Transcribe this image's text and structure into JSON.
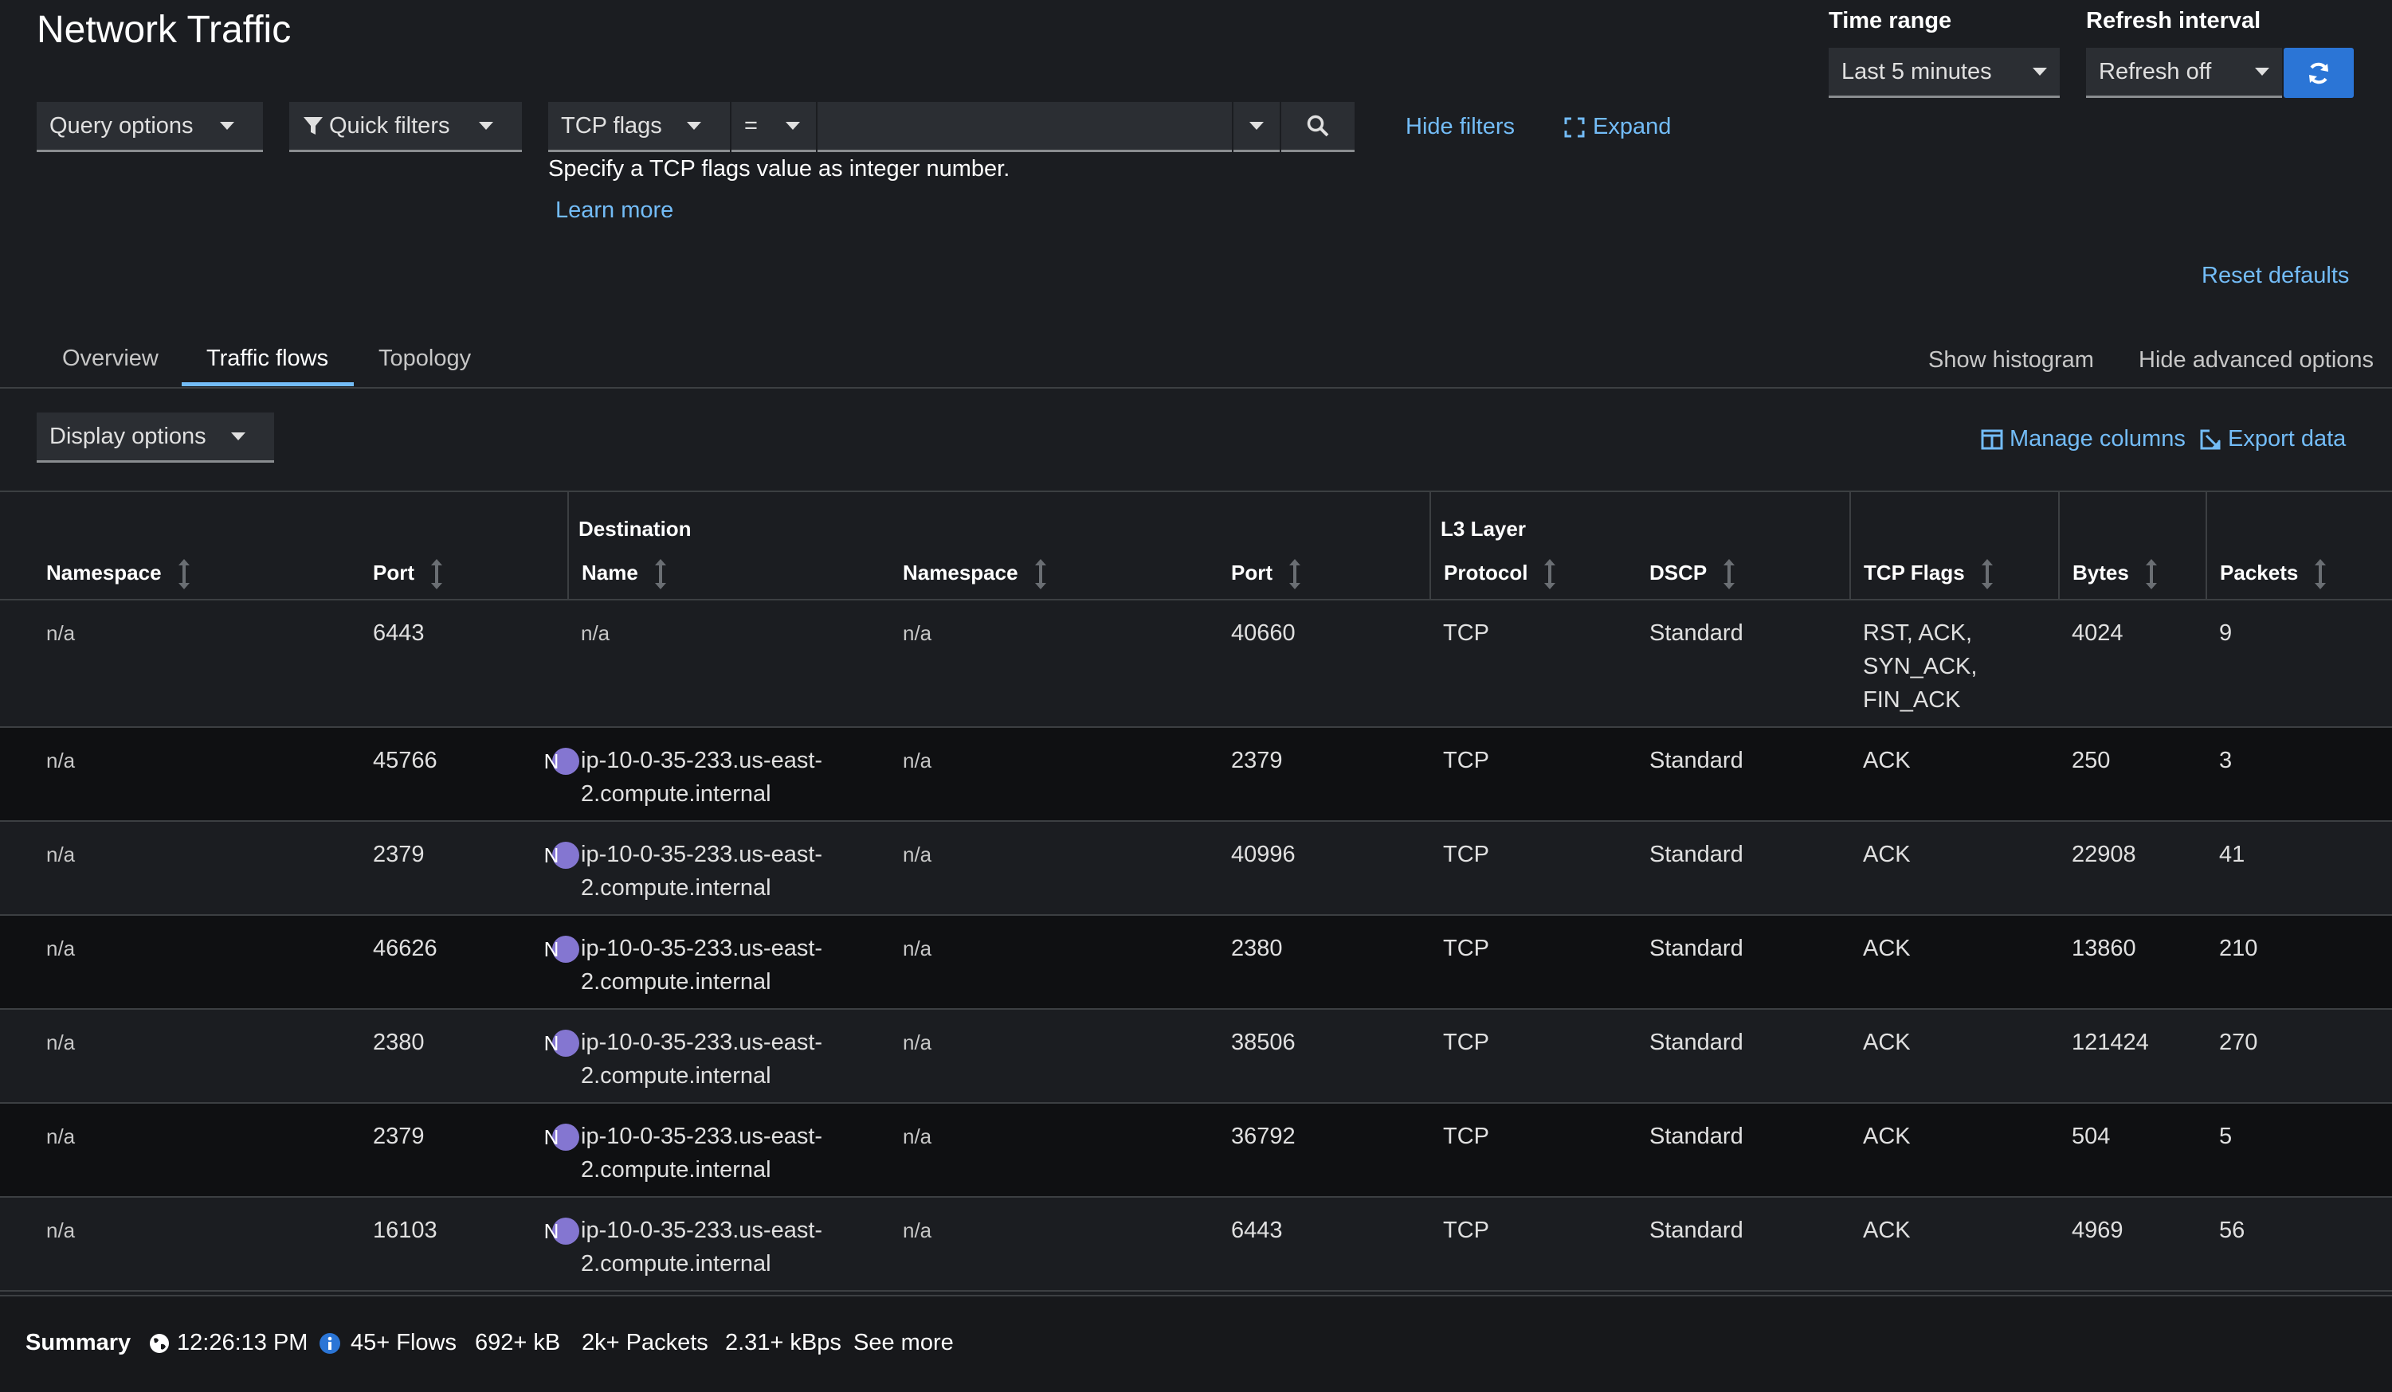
{
  "page": {
    "title": "Network Traffic"
  },
  "time_range": {
    "label": "Time range",
    "value": "Last 5 minutes"
  },
  "refresh": {
    "label": "Refresh interval",
    "value": "Refresh off"
  },
  "toolbar": {
    "query_options": "Query options",
    "quick_filters": "Quick filters",
    "filter_field": "TCP flags",
    "filter_operator": "=",
    "filter_value": "",
    "hide_filters": "Hide filters",
    "expand": "Expand",
    "helper_text": "Specify a TCP flags value as integer number.",
    "learn_more": "Learn more",
    "reset_defaults": "Reset defaults"
  },
  "tabs": [
    {
      "label": "Overview",
      "active": false
    },
    {
      "label": "Traffic flows",
      "active": true
    },
    {
      "label": "Topology",
      "active": false
    }
  ],
  "tab_actions": {
    "show_histogram": "Show histogram",
    "hide_advanced": "Hide advanced options"
  },
  "display_options": "Display options",
  "table_actions": {
    "manage_columns": "Manage columns",
    "export_data": "Export data"
  },
  "table": {
    "groups": {
      "destination": "Destination",
      "l3": "L3 Layer"
    },
    "columns": [
      "Namespace",
      "Port",
      "Name",
      "Namespace",
      "Port",
      "Protocol",
      "DSCP",
      "TCP Flags",
      "Bytes",
      "Packets"
    ],
    "rows": [
      {
        "src_ns": "n/a",
        "src_port": "6443",
        "dst_badge": "",
        "dst_name": "n/a",
        "dst_ns": "n/a",
        "dst_port": "40660",
        "protocol": "TCP",
        "dscp": "Standard",
        "flags": "RST, ACK, SYN_ACK, FIN_ACK",
        "bytes": "4024",
        "packets": "9"
      },
      {
        "src_ns": "n/a",
        "src_port": "45766",
        "dst_badge": "N",
        "dst_name": "ip-10-0-35-233.us-east-2.compute.internal",
        "dst_ns": "n/a",
        "dst_port": "2379",
        "protocol": "TCP",
        "dscp": "Standard",
        "flags": "ACK",
        "bytes": "250",
        "packets": "3"
      },
      {
        "src_ns": "n/a",
        "src_port": "2379",
        "dst_badge": "N",
        "dst_name": "ip-10-0-35-233.us-east-2.compute.internal",
        "dst_ns": "n/a",
        "dst_port": "40996",
        "protocol": "TCP",
        "dscp": "Standard",
        "flags": "ACK",
        "bytes": "22908",
        "packets": "41"
      },
      {
        "src_ns": "n/a",
        "src_port": "46626",
        "dst_badge": "N",
        "dst_name": "ip-10-0-35-233.us-east-2.compute.internal",
        "dst_ns": "n/a",
        "dst_port": "2380",
        "protocol": "TCP",
        "dscp": "Standard",
        "flags": "ACK",
        "bytes": "13860",
        "packets": "210"
      },
      {
        "src_ns": "n/a",
        "src_port": "2380",
        "dst_badge": "N",
        "dst_name": "ip-10-0-35-233.us-east-2.compute.internal",
        "dst_ns": "n/a",
        "dst_port": "38506",
        "protocol": "TCP",
        "dscp": "Standard",
        "flags": "ACK",
        "bytes": "121424",
        "packets": "270"
      },
      {
        "src_ns": "n/a",
        "src_port": "2379",
        "dst_badge": "N",
        "dst_name": "ip-10-0-35-233.us-east-2.compute.internal",
        "dst_ns": "n/a",
        "dst_port": "36792",
        "protocol": "TCP",
        "dscp": "Standard",
        "flags": "ACK",
        "bytes": "504",
        "packets": "5"
      },
      {
        "src_ns": "n/a",
        "src_port": "16103",
        "dst_badge": "N",
        "dst_name": "ip-10-0-35-233.us-east-2.compute.internal",
        "dst_ns": "n/a",
        "dst_port": "6443",
        "protocol": "TCP",
        "dscp": "Standard",
        "flags": "ACK",
        "bytes": "4969",
        "packets": "56"
      }
    ]
  },
  "summary": {
    "label": "Summary",
    "time": "12:26:13 PM",
    "flows": "45+ Flows",
    "size": "692+ kB",
    "packets": "2k+ Packets",
    "rate": "2.31+ kBps",
    "see_more": "See more"
  },
  "colors": {
    "accent": "#73bcf7",
    "primary_button": "#2b75d6",
    "badge": "#8476d1"
  },
  "icons": [
    "filter-icon",
    "search-icon",
    "expand-icon",
    "refresh-icon",
    "columns-icon",
    "export-icon",
    "globe-icon",
    "info-icon"
  ]
}
